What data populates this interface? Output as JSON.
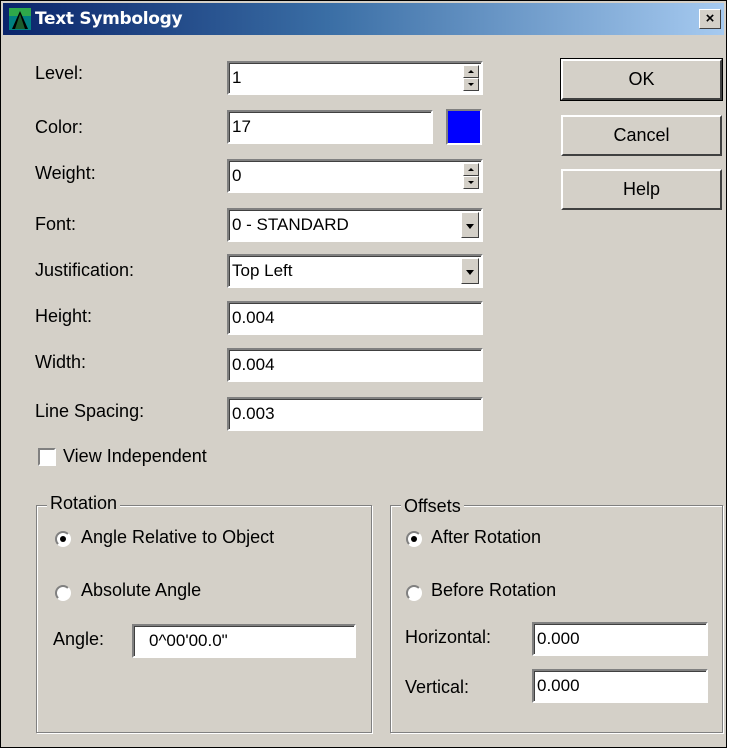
{
  "window": {
    "title": "Text Symbology",
    "close_glyph": "×"
  },
  "fields": {
    "level": {
      "label": "Level:",
      "value": "1"
    },
    "color": {
      "label": "Color:",
      "value": "17",
      "swatch": "#0000ff"
    },
    "weight": {
      "label": "Weight:",
      "value": "0"
    },
    "font": {
      "label": "Font:",
      "value": "0 - STANDARD"
    },
    "justification": {
      "label": "Justification:",
      "value": "Top Left"
    },
    "height": {
      "label": "Height:",
      "value": "0.004"
    },
    "width": {
      "label": "Width:",
      "value": "0.004"
    },
    "line_spacing": {
      "label": "Line Spacing:",
      "value": "0.003"
    }
  },
  "view_independent": {
    "label": "View Independent",
    "checked": false
  },
  "buttons": {
    "ok": "OK",
    "cancel": "Cancel",
    "help": "Help"
  },
  "rotation": {
    "title": "Rotation",
    "options": [
      "Angle Relative to Object",
      "Absolute Angle"
    ],
    "selected": "Angle Relative to Object",
    "angle_label": "Angle:",
    "angle_value": "0^00'00.0\""
  },
  "offsets": {
    "title": "Offsets",
    "options": [
      "After Rotation",
      "Before Rotation"
    ],
    "selected": "After Rotation",
    "horizontal_label": "Horizontal:",
    "horizontal_value": "0.000",
    "vertical_label": "Vertical:",
    "vertical_value": "0.000"
  },
  "icons": {
    "app": "app-icon",
    "close": "close-icon",
    "spin": "spin-arrows-icon",
    "dropdown": "chevron-down-icon"
  }
}
